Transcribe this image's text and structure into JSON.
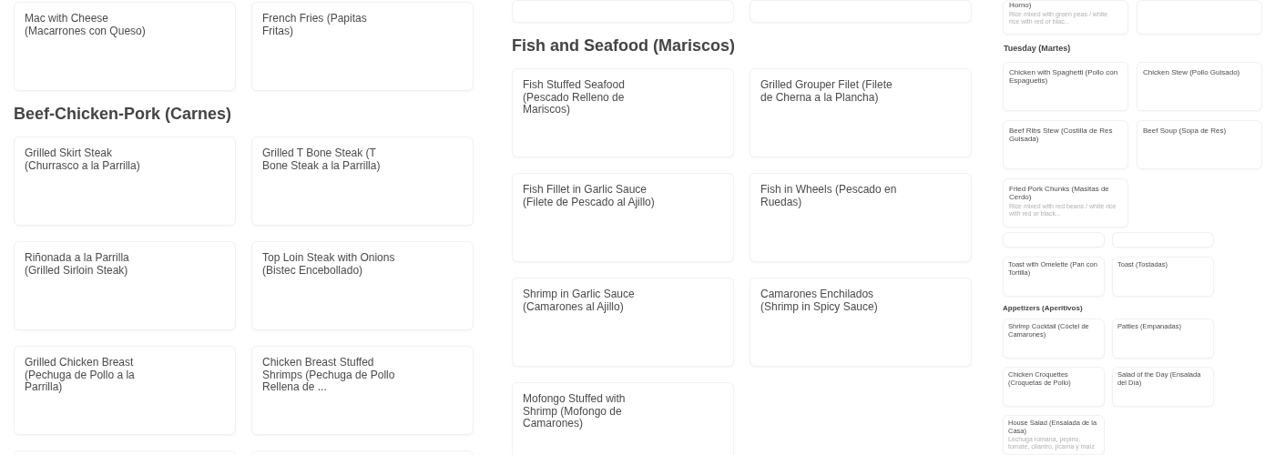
{
  "panels": [
    {
      "kind": "large",
      "sections": [
        {
          "items": [
            {
              "kind": "dish",
              "name": "Mac with Cheese (Macarrones con Queso)"
            },
            {
              "kind": "dish",
              "name": "French Fries (Papitas Fritas)"
            }
          ]
        },
        {
          "heading": "Beef-Chicken-Pork (Carnes)",
          "items": [
            {
              "kind": "dish",
              "name": "Grilled Skirt Steak (Churrasco a la Parrilla)"
            },
            {
              "kind": "dish",
              "name": "Grilled T Bone Steak (T Bone Steak a la Parrilla)"
            },
            {
              "kind": "dish",
              "name": "Riñonada a la Parrilla (Grilled Sirloin Steak)"
            },
            {
              "kind": "dish",
              "name": "Top Loin Steak with Onions (Bistec Encebollado)"
            },
            {
              "kind": "dish",
              "name": "Grilled Chicken Breast (Pechuga de Pollo a la Parrilla)"
            },
            {
              "kind": "dish",
              "name": "Chicken Breast Stuffed Shrimps (Pechuga de Pollo Rellena de ..."
            },
            {
              "kind": "blank"
            },
            {
              "kind": "blank"
            }
          ]
        }
      ]
    },
    {
      "kind": "large",
      "sections": [
        {
          "items": [
            {
              "kind": "blank"
            },
            {
              "kind": "blank"
            }
          ]
        },
        {
          "heading": "Fish and Seafood (Mariscos)",
          "items": [
            {
              "kind": "dish",
              "name": "Fish Stuffed Seafood (Pescado Relleno de Mariscos)"
            },
            {
              "kind": "dish",
              "name": "Grilled Grouper Filet (Filete de Cherna a la Plancha)"
            },
            {
              "kind": "dish",
              "name": "Fish Fillet in Garlic Sauce (Filete de Pescado al Ajillo)"
            },
            {
              "kind": "dish",
              "name": "Fish in Wheels (Pescado en Ruedas)"
            },
            {
              "kind": "dish",
              "name": "Shrimp in Garlic Sauce (Camarones al Ajillo)"
            },
            {
              "kind": "dish",
              "name": "Camarones Enchilados (Shrimp in Spicy Sauce)"
            },
            {
              "kind": "dish",
              "name": "Mofongo Stuffed with Shrimp (Mofongo de Camarones)"
            }
          ]
        }
      ]
    },
    {
      "kind": "small",
      "sections": [
        {
          "items": [
            {
              "kind": "cut",
              "name": "Horno)",
              "description": "Rice mixed with green peas / white rice with red or blac..."
            },
            {
              "kind": "blank"
            }
          ]
        },
        {
          "heading": "Tuesday (Martes)",
          "items": [
            {
              "kind": "dish",
              "name": "Chicken with Spaghetti (Pollo con Espaguetis)"
            },
            {
              "kind": "dish",
              "name": "Chicken Stew (Pollo Guisado)"
            },
            {
              "kind": "dish",
              "name": "Beef Ribs Stew (Costilla de Res Guisada)"
            },
            {
              "kind": "dish",
              "name": "Beef Soup (Sopa de Res)"
            },
            {
              "kind": "dish",
              "name": "Fried Pork Chunks (Masitas de Cerdo)",
              "description": "Rice mixed with red beans / white rice with red or black..."
            }
          ]
        }
      ]
    },
    {
      "kind": "tiny",
      "sections": [
        {
          "items": [
            {
              "kind": "blank"
            },
            {
              "kind": "blank"
            },
            {
              "kind": "dish",
              "name": "Toast with Omelette (Pan con Tortilla)"
            },
            {
              "kind": "dish",
              "name": "Toast (Tostadas)"
            }
          ]
        },
        {
          "heading": "Appetizers (Aperitivos)",
          "items": [
            {
              "kind": "dish",
              "name": "Shrimp Cocktail (Cóctel de Camarones)"
            },
            {
              "kind": "dish",
              "name": "Patties (Empanadas)"
            },
            {
              "kind": "dish",
              "name": "Chicken Croquettes (Croquetas de Pollo)"
            },
            {
              "kind": "dish",
              "name": "Salad of the Day (Ensalada del Día)"
            },
            {
              "kind": "dish",
              "name": "House Salad (Ensalada de la Casa)",
              "description": "Lechuga romana, pepino, tomate, cilantro, jícama y maíz"
            }
          ]
        }
      ]
    }
  ]
}
